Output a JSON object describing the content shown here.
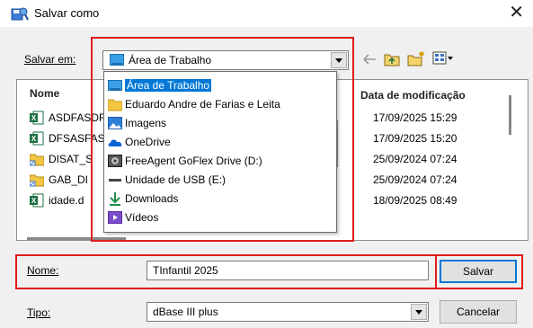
{
  "window": {
    "title": "Salvar como"
  },
  "toolbar": {
    "location_label": "Salvar em:",
    "location_value": "Área de Trabalho"
  },
  "list": {
    "col_name": "Nome",
    "col_date": "Data de modificação",
    "rows": [
      {
        "name": "ASDFASDF",
        "date": "17/09/2025 15:29",
        "icon": "excel-icon"
      },
      {
        "name": "DFSASFAS",
        "date": "17/09/2025 15:20",
        "icon": "excel-icon"
      },
      {
        "name": "DISAT_S",
        "date": "25/09/2024 07:24",
        "icon": "folder-shortcut-icon"
      },
      {
        "name": "GAB_DI",
        "date": "25/09/2024 07:24",
        "icon": "folder-shortcut-icon"
      },
      {
        "name": "idade.d",
        "date": "18/09/2025 08:49",
        "icon": "excel-icon"
      }
    ]
  },
  "dropdown": {
    "items": [
      {
        "label": "Área de Trabalho",
        "icon": "desktop-icon",
        "selected": true
      },
      {
        "label": "Eduardo Andre de Farias e Leita",
        "icon": "folder-icon",
        "selected": false
      },
      {
        "label": "Imagens",
        "icon": "pictures-icon",
        "selected": false
      },
      {
        "label": "OneDrive",
        "icon": "onedrive-icon",
        "selected": false
      },
      {
        "label": "FreeAgent GoFlex Drive (D:)",
        "icon": "external-drive-icon",
        "selected": false
      },
      {
        "label": "Unidade de USB (E:)",
        "icon": "usb-drive-icon",
        "selected": false
      },
      {
        "label": "Downloads",
        "icon": "downloads-icon",
        "selected": false
      },
      {
        "label": "Vídeos",
        "icon": "videos-icon",
        "selected": false
      }
    ]
  },
  "form": {
    "name_label": "Nome:",
    "name_value": "TInfantil 2025",
    "type_label": "Tipo:",
    "type_value": "dBase III plus",
    "save_label": "Salvar",
    "cancel_label": "Cancelar"
  },
  "colors": {
    "highlight": "#e01c1c",
    "selection": "#0078d7",
    "excel": "#1d6f42",
    "folder": "#f4c542"
  }
}
